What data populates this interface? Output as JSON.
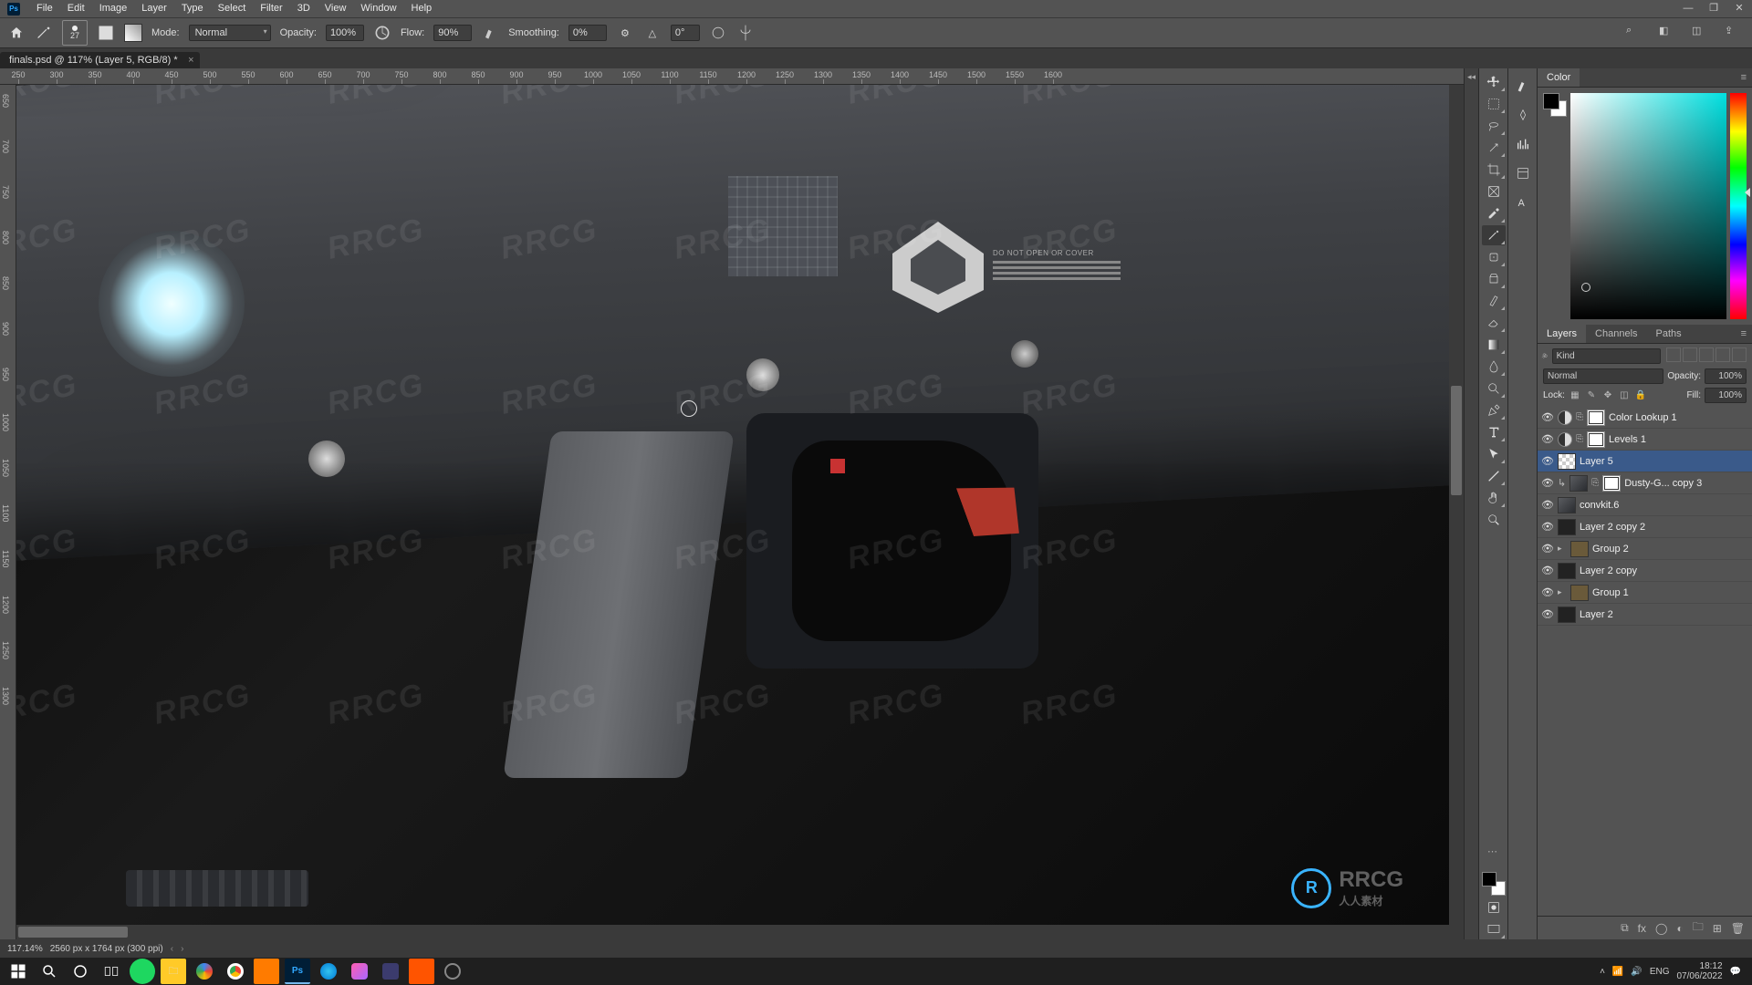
{
  "menu": {
    "items": [
      "File",
      "Edit",
      "Image",
      "Layer",
      "Type",
      "Select",
      "Filter",
      "3D",
      "View",
      "Window",
      "Help"
    ]
  },
  "options": {
    "brush_size": "27",
    "mode_label": "Mode:",
    "mode_value": "Normal",
    "opacity_label": "Opacity:",
    "opacity_value": "100%",
    "flow_label": "Flow:",
    "flow_value": "90%",
    "smoothing_label": "Smoothing:",
    "smoothing_value": "0%",
    "angle_value": "0°"
  },
  "doc_tab": {
    "title": "finals.psd @ 117% (Layer 5, RGB/8) *"
  },
  "ruler_marks": [
    250,
    300,
    350,
    400,
    450,
    500,
    550,
    600,
    650,
    700,
    750,
    800,
    850,
    900,
    950,
    1000,
    1050,
    1100,
    1150,
    1200,
    1250,
    1300,
    1350,
    1400,
    1450,
    1500,
    1550,
    1600
  ],
  "ruler_v": [
    "650",
    "700",
    "750",
    "800",
    "850",
    "900",
    "950",
    "1000",
    "1050",
    "1100",
    "1150",
    "1200",
    "1250",
    "1300"
  ],
  "panels": {
    "color_tab": "Color",
    "layers_tabs": [
      "Layers",
      "Channels",
      "Paths"
    ],
    "kind_label": "Kind",
    "blend_mode": "Normal",
    "opacity_label": "Opacity:",
    "opacity_value": "100%",
    "lock_label": "Lock:",
    "fill_label": "Fill:",
    "fill_value": "100%"
  },
  "layers": [
    {
      "name": "Color Lookup 1",
      "type": "adj",
      "visible": true
    },
    {
      "name": "Levels 1",
      "type": "adj",
      "visible": true
    },
    {
      "name": "Layer 5",
      "type": "pixel",
      "visible": true,
      "selected": true,
      "thumb": "checker"
    },
    {
      "name": "Dusty-G... copy 3",
      "type": "pixel",
      "visible": true,
      "thumb": "img",
      "hasMask": true,
      "clipped": true
    },
    {
      "name": "convkit.6",
      "type": "pixel",
      "visible": true,
      "thumb": "img"
    },
    {
      "name": "Layer 2 copy 2",
      "type": "pixel",
      "visible": true,
      "thumb": "dark"
    },
    {
      "name": "Group 2",
      "type": "group",
      "visible": true
    },
    {
      "name": "Layer 2 copy",
      "type": "pixel",
      "visible": true,
      "thumb": "dark"
    },
    {
      "name": "Group 1",
      "type": "group",
      "visible": true
    },
    {
      "name": "Layer 2",
      "type": "pixel",
      "visible": true,
      "thumb": "dark"
    }
  ],
  "status": {
    "zoom": "117.14%",
    "dims": "2560 px x 1764 px (300 ppi)"
  },
  "canvas_label": "DO NOT OPEN OR COVER",
  "watermark_text": "RRCG",
  "watermark_sub": "人人素材",
  "tray": {
    "time": "18:12",
    "date": "07/06/2022"
  }
}
